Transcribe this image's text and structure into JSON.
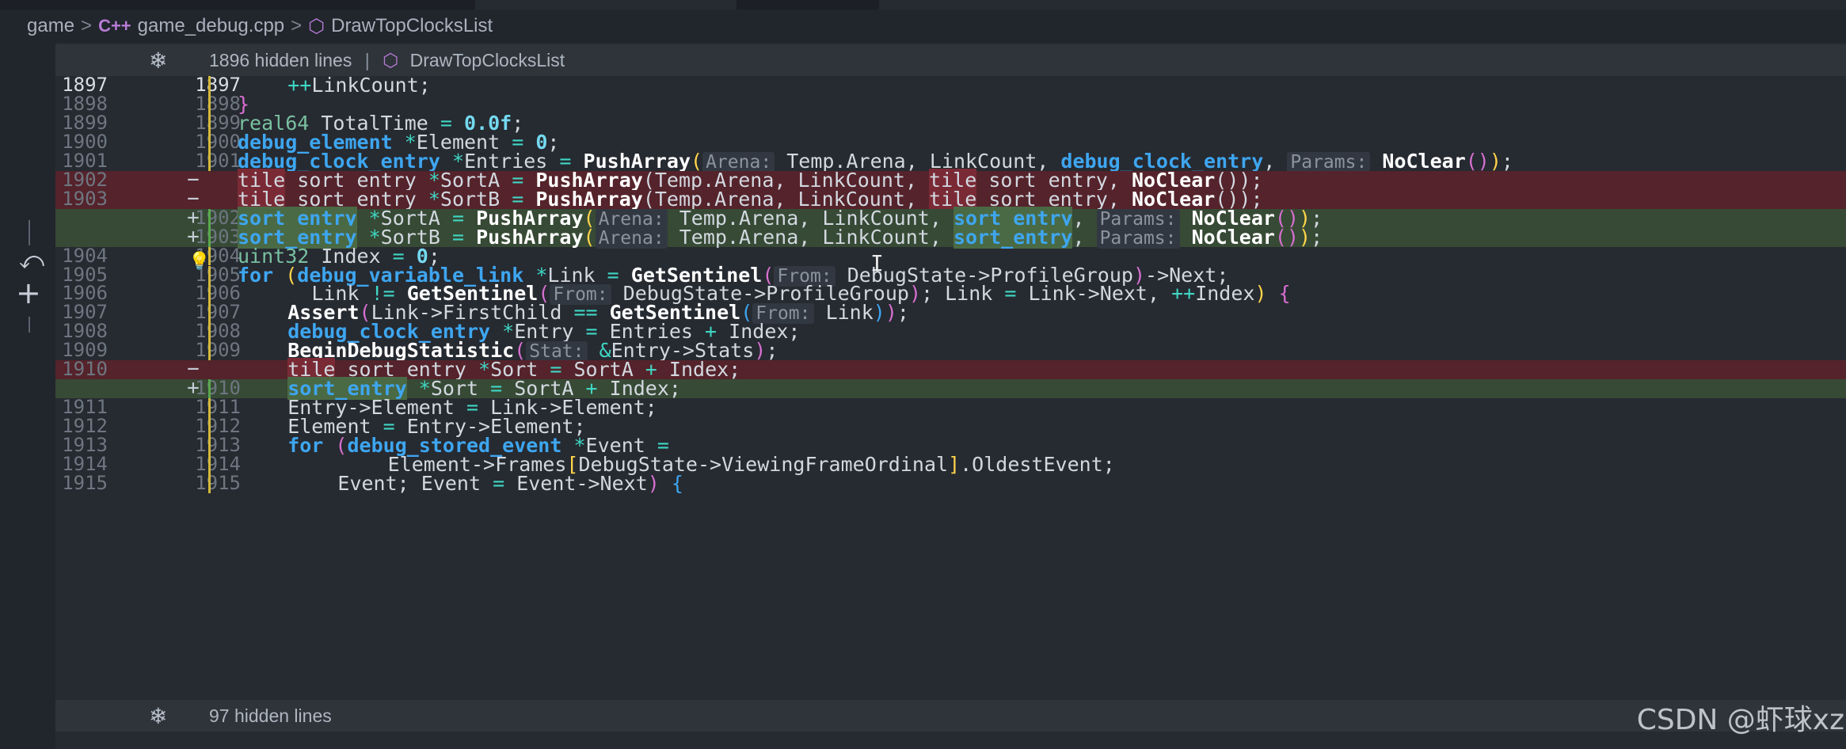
{
  "breadcrumb": {
    "folder": "game",
    "file": "game_debug.cpp",
    "symbol": "DrawTopClocksList",
    "sep": ">"
  },
  "banner_top": {
    "text": "1896 hidden lines",
    "separator": "|",
    "symbol": "DrawTopClocksList"
  },
  "banner_bottom": {
    "text": "97 hidden lines"
  },
  "icons": {
    "snowflake": "❄",
    "cube": "⬡",
    "undo": "⤺",
    "plus": "+",
    "bulb": "💡",
    "cpp": "C++"
  },
  "lines": [
    {
      "old": "1897",
      "new": "1897",
      "mark": "",
      "kind": "ctx",
      "cur": true
    },
    {
      "old": "1898",
      "new": "1898",
      "mark": "",
      "kind": "ctx"
    },
    {
      "old": "1899",
      "new": "1899",
      "mark": "",
      "kind": "ctx"
    },
    {
      "old": "1900",
      "new": "1900",
      "mark": "",
      "kind": "ctx"
    },
    {
      "old": "1901",
      "new": "1901",
      "mark": "",
      "kind": "ctx"
    },
    {
      "old": "1902",
      "new": "",
      "mark": "−",
      "kind": "del"
    },
    {
      "old": "1903",
      "new": "",
      "mark": "−",
      "kind": "del"
    },
    {
      "old": "",
      "new": "1902",
      "mark": "+",
      "kind": "add"
    },
    {
      "old": "",
      "new": "1903",
      "mark": "+",
      "kind": "add"
    },
    {
      "old": "1904",
      "new": "1904",
      "mark": "",
      "kind": "ctx"
    },
    {
      "old": "1905",
      "new": "1905",
      "mark": "",
      "kind": "ctx"
    },
    {
      "old": "1906",
      "new": "1906",
      "mark": "",
      "kind": "ctx"
    },
    {
      "old": "1907",
      "new": "1907",
      "mark": "",
      "kind": "ctx"
    },
    {
      "old": "1908",
      "new": "1908",
      "mark": "",
      "kind": "ctx"
    },
    {
      "old": "1909",
      "new": "1909",
      "mark": "",
      "kind": "ctx"
    },
    {
      "old": "1910",
      "new": "",
      "mark": "−",
      "kind": "del"
    },
    {
      "old": "",
      "new": "1910",
      "mark": "+",
      "kind": "add"
    },
    {
      "old": "1911",
      "new": "1911",
      "mark": "",
      "kind": "ctx"
    },
    {
      "old": "1912",
      "new": "1912",
      "mark": "",
      "kind": "ctx"
    },
    {
      "old": "1913",
      "new": "1913",
      "mark": "",
      "kind": "ctx"
    },
    {
      "old": "1914",
      "new": "1914",
      "mark": "",
      "kind": "ctx"
    },
    {
      "old": "1915",
      "new": "1915",
      "mark": "",
      "kind": "ctx"
    }
  ],
  "code": {
    "l0_a": "++",
    "l0_b": "LinkCount;",
    "l1_a": "}",
    "l2_a": "real64",
    "l2_b": " TotalTime ",
    "l2_c": "=",
    "l2_d": " ",
    "l2_e": "0.0f",
    "l2_f": ";",
    "l3_a": "debug_element",
    "l3_b": " ",
    "l3_c": "*",
    "l3_d": "Element ",
    "l3_e": "=",
    "l3_f": " ",
    "l3_g": "0",
    "l3_h": ";",
    "l4_a": "debug_clock_entry",
    "l4_b": " ",
    "l4_c": "*",
    "l4_d": "Entries ",
    "l4_e": "=",
    "l4_f": " ",
    "l4_g": "PushArray",
    "l4_h": "(",
    "l4_i": "Arena:",
    "l4_j": " Temp.Arena, LinkCount, ",
    "l4_k": "debug_clock_entry",
    "l4_l": ", ",
    "l4_m": "Params:",
    "l4_n": " ",
    "l4_o": "NoClear",
    "l4_p": "()",
    "l4_q": ")",
    ";": ";",
    "l5_a": "tile",
    "l5_b": "_sort_entry ",
    "l5_c": "*",
    "l5_d": "SortA ",
    "l5_e": "=",
    "l5_f": " ",
    "l5_g": "PushArray",
    "l5_h": "(Temp.Arena, LinkCount, ",
    "l5_i": "tile",
    "l5_j": "_sort_entry, ",
    "l5_k": "NoClear",
    "l5_l": "());",
    "l6_a": "tile",
    "l6_b": "_sort_entry ",
    "l6_c": "*",
    "l6_d": "SortB ",
    "l6_e": "=",
    "l6_f": " ",
    "l6_g": "PushArray",
    "l6_h": "(Temp.Arena, Li",
    "l6_h2": "nkCount, ",
    "l6_i": "tile",
    "l6_j": "_sort_entry, ",
    "l6_k": "NoClear",
    "l6_l": "());",
    "l7_a": "sort_entry",
    "l7_b": " ",
    "l7_c": "*",
    "l7_d": "SortA ",
    "l7_e": "=",
    "l7_f": " ",
    "l7_g": "PushArray",
    "l7_h": "(",
    "l7_i": "Arena:",
    "l7_j": " Temp.Arena, LinkCount, ",
    "l7_k": "sort_entry",
    "l7_l": ", ",
    "l7_m": "Params:",
    "l7_n": " ",
    "l7_o": "NoClear",
    "l7_p": "()",
    "l7_q": ")",
    "l8_a": "sort_entry",
    "l8_b": " ",
    "l8_c": "*",
    "l8_d": "SortB ",
    "l8_e": "=",
    "l8_f": " ",
    "l8_g": "PushArray",
    "l8_h": "(",
    "l8_i": "Arena:",
    "l8_j": " Temp.Arena, LinkCount, ",
    "l8_k": "sort_entry",
    "l8_l": ", ",
    "l8_m": "Params:",
    "l8_n": " ",
    "l8_o": "NoClear",
    "l8_p": "()",
    "l8_q": ")",
    "l9_a": "uint32",
    "l9_b": " Index ",
    "l9_c": "=",
    "l9_d": " ",
    "l9_e": "0",
    "l9_f": ";",
    "l10_a": "for",
    "l10_b": " ",
    "l10_c": "(",
    "l10_d": "debug_variable_link",
    "l10_e": " ",
    "l10_f": "*",
    "l10_g": "Link ",
    "l10_h": "=",
    "l10_i": " ",
    "l10_j": "GetSentinel",
    "l10_k": "(",
    "l10_l": "From:",
    "l10_m": " DebugState->ProfileGroup",
    "l10_n": ")",
    "l10_o": "->Next;",
    "l11_a": "Link ",
    "l11_b": "!=",
    "l11_c": " ",
    "l11_d": "GetSentinel",
    "l11_e": "(",
    "l11_f": "From:",
    "l11_g": " DebugState->ProfileGroup",
    "l11_h": ")",
    "l11_i": "; Link ",
    "l11_j": "=",
    "l11_k": " Link->Next, ",
    "l11_l": "++",
    "l11_m": "Index",
    ")": ")",
    " {": " {",
    "l12_a": "Assert",
    "l12_b": "(",
    "l12_c": "Link->FirstChild ",
    "l12_d": "==",
    "l12_e": " ",
    "l12_f": "GetSentinel",
    "l12_g": "(",
    "l12_h": "From:",
    "l12_i": " Link",
    "l12_j": ")",
    "l12_k": ")",
    "l12_l": ";",
    "l13_a": "debug_clock_entry",
    "l13_b": " ",
    "l13_c": "*",
    "l13_d": "Entry ",
    "l13_e": "=",
    "l13_f": " Entries ",
    "l13_g": "+",
    "l13_h": " Index;",
    "l14_a": "BeginDebugStatistic",
    "l14_b": "(",
    "l14_c": "Stat:",
    "l14_d": " ",
    "l14_e": "&",
    "l14_f": "Entry->Stats",
    "l14_g": ")",
    "l14_h": ";",
    "l15_a": "tile",
    "l15_b": "_sort_entry ",
    "l15_c": "*",
    "l15_d": "Sort ",
    "l15_e": "=",
    "l15_f": " SortA ",
    "l15_g": "+",
    "l15_h": " Index;",
    "l16_a": "sort_entry",
    "l16_b": " ",
    "l16_c": "*",
    "l16_d": "Sort ",
    "l16_e": "=",
    "l16_f": " SortA ",
    "l16_g": "+",
    "l16_h": " Index;",
    "l17_a": "Entry->Element ",
    "l17_b": "=",
    "l17_c": " Link->Element;",
    "l18_a": "Element ",
    "l18_b": "=",
    "l18_c": " Entry->Element;",
    "l19_a": "for",
    "l19_b": " ",
    "l19_c": "(",
    "l19_d": "debug_stored_event",
    "l19_e": " ",
    "l19_f": "*",
    "l19_g": "Event ",
    "l19_h": "=",
    "l20_a": "Element->Frames",
    "l20_b": "[",
    "l20_c": "DebugState->ViewingFrameOrdinal",
    "l20_d": "]",
    "l20_e": ".OldestEvent;",
    "l21_a": "Event; Event ",
    "l21_b": "=",
    "l21_c": " Event->Next",
    "l21_d": ")",
    "l21_e": " {"
  },
  "watermark": "CSDN @虾球xz",
  "colors": {
    "deleted_bg": "#55232b",
    "added_bg": "#374a35",
    "modified_bar": "#d4b93a",
    "added_bar": "#5aa84f"
  }
}
